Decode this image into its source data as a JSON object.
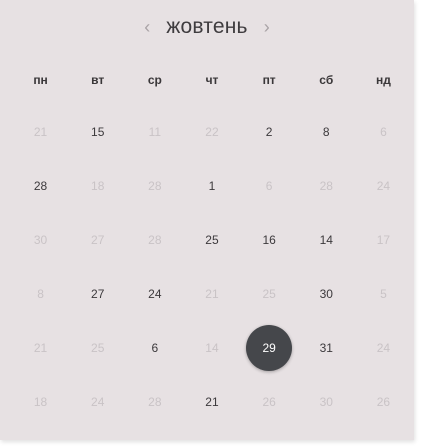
{
  "calendar": {
    "prev_icon": "chevron-left-icon",
    "next_icon": "chevron-right-icon",
    "prev_glyph": "‹",
    "next_glyph": "›",
    "month": "жовтень",
    "weekdays": [
      "пн",
      "вт",
      "ср",
      "чт",
      "пт",
      "сб",
      "нд"
    ],
    "rows": [
      [
        {
          "d": "21",
          "s": "muted"
        },
        {
          "d": "15",
          "s": "active"
        },
        {
          "d": "11",
          "s": "muted"
        },
        {
          "d": "22",
          "s": "muted"
        },
        {
          "d": "2",
          "s": "active"
        },
        {
          "d": "8",
          "s": "active"
        },
        {
          "d": "6",
          "s": "muted"
        }
      ],
      [
        {
          "d": "28",
          "s": "active"
        },
        {
          "d": "18",
          "s": "muted"
        },
        {
          "d": "28",
          "s": "muted"
        },
        {
          "d": "1",
          "s": "active"
        },
        {
          "d": "6",
          "s": "muted"
        },
        {
          "d": "28",
          "s": "muted"
        },
        {
          "d": "24",
          "s": "muted"
        }
      ],
      [
        {
          "d": "30",
          "s": "muted"
        },
        {
          "d": "27",
          "s": "muted"
        },
        {
          "d": "28",
          "s": "muted"
        },
        {
          "d": "25",
          "s": "active"
        },
        {
          "d": "16",
          "s": "active"
        },
        {
          "d": "14",
          "s": "active"
        },
        {
          "d": "17",
          "s": "muted"
        }
      ],
      [
        {
          "d": "8",
          "s": "muted"
        },
        {
          "d": "27",
          "s": "active"
        },
        {
          "d": "24",
          "s": "active"
        },
        {
          "d": "21",
          "s": "muted"
        },
        {
          "d": "25",
          "s": "muted"
        },
        {
          "d": "30",
          "s": "active"
        },
        {
          "d": "5",
          "s": "muted"
        }
      ],
      [
        {
          "d": "21",
          "s": "muted"
        },
        {
          "d": "25",
          "s": "muted"
        },
        {
          "d": "6",
          "s": "active"
        },
        {
          "d": "14",
          "s": "muted"
        },
        {
          "d": "29",
          "s": "selected"
        },
        {
          "d": "31",
          "s": "active"
        },
        {
          "d": "24",
          "s": "muted"
        }
      ],
      [
        {
          "d": "18",
          "s": "muted"
        },
        {
          "d": "24",
          "s": "muted"
        },
        {
          "d": "28",
          "s": "muted"
        },
        {
          "d": "21",
          "s": "active"
        },
        {
          "d": "26",
          "s": "muted"
        },
        {
          "d": "30",
          "s": "muted"
        },
        {
          "d": "26",
          "s": "muted"
        }
      ]
    ],
    "colors": {
      "background": "#e7e1e3",
      "text": "#3c393c",
      "muted_text": "#c9c3c6",
      "selected_bg": "#45474b",
      "selected_text": "#ffffff"
    }
  }
}
